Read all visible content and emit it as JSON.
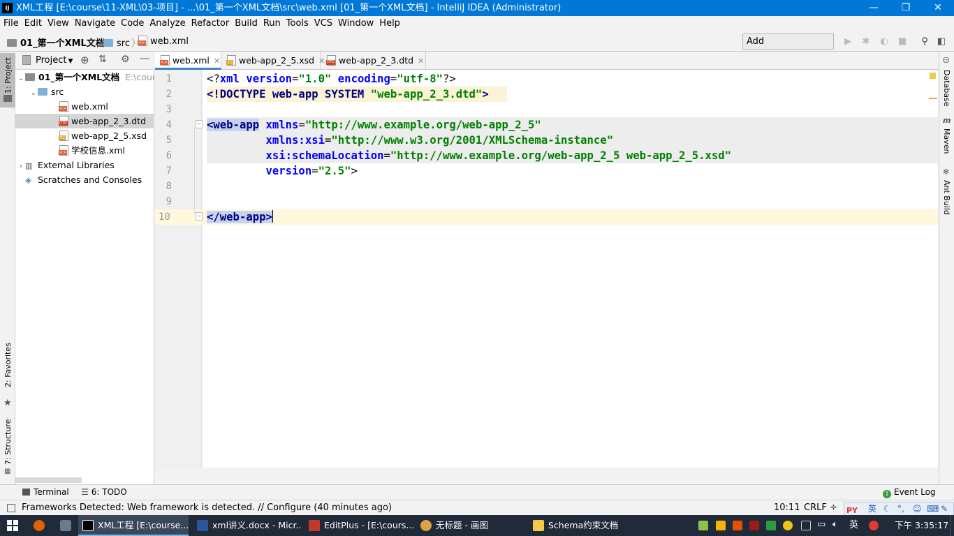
{
  "window": {
    "title": "XML工程 [E:\\course\\11-XML\\03-项目] - ...\\01_第一个XML文档\\src\\web.xml [01_第一个XML文档] - IntelliJ IDEA (Administrator)",
    "icon_label": "IJ",
    "minimize": "—",
    "restore": "❐",
    "close": "✕"
  },
  "menu": [
    "File",
    "Edit",
    "View",
    "Navigate",
    "Code",
    "Analyze",
    "Refactor",
    "Build",
    "Run",
    "Tools",
    "VCS",
    "Window",
    "Help"
  ],
  "breadcrumb": {
    "project": "01_第一个XML文档",
    "folder": "src",
    "file": "web.xml",
    "sep": "〉"
  },
  "toolbar": {
    "add_configuration": "Add Configuration..."
  },
  "left_strip": {
    "project": "1: Project",
    "favorites": "2: Favorites",
    "structure": "7: Structure"
  },
  "project_panel": {
    "header": "Project",
    "root_name": "01_第一个XML文档",
    "root_path": "E:\\cours",
    "items": [
      "src",
      "web.xml",
      "web-app_2_3.dtd",
      "web-app_2_5.xsd",
      "学校信息.xml",
      "External Libraries",
      "Scratches and Consoles"
    ]
  },
  "tabs": [
    "web.xml",
    "web-app_2_5.xsd",
    "web-app_2_3.dtd"
  ],
  "gutter_lines": [
    "1",
    "2",
    "3",
    "4",
    "5",
    "6",
    "7",
    "8",
    "9",
    "10"
  ],
  "code": {
    "l1": {
      "a": "<?",
      "b": "xml",
      "c": " version",
      "d": "=",
      "e": "\"1.0\"",
      "f": " encoding",
      "g": "=",
      "h": "\"utf-8\"",
      "i": "?>"
    },
    "l2": {
      "a": "<!DOCTYPE web-app SYSTEM ",
      "b": "\"web-app_2_3.dtd\"",
      "c": ">"
    },
    "l4": {
      "a": "<web-app",
      "b": " xmlns",
      "c": "=",
      "d": "\"http://www.example.org/web-app_2_5\""
    },
    "l5": {
      "a": "         xmlns:xsi",
      "b": "=",
      "c": "\"http://www.w3.org/2001/XMLSchema-instance\""
    },
    "l6": {
      "a": "         xsi:schemaLocation",
      "b": "=",
      "c": "\"http://www.example.org/web-app_2_5 web-app_2_5.xsd\""
    },
    "l7": {
      "a": "         version",
      "b": "=",
      "c": "\"2.5\"",
      "d": ">"
    },
    "l10": {
      "a": "</web-app>"
    }
  },
  "right_strip": {
    "database": "Database",
    "maven": "Maven",
    "ant": "Ant Build"
  },
  "bottom": {
    "terminal": "Terminal",
    "todo": "6: TODO",
    "event_log": "Event Log"
  },
  "status": {
    "message": "Frameworks Detected: Web framework is detected. // Configure (40 minutes ago)",
    "position": "10:11",
    "line_sep": "CRLF ÷"
  },
  "taskbar": {
    "items": [
      "XML工程 [E:\\course...",
      "xml讲义.docx - Micr...",
      "EditPlus - [E:\\cours...",
      "无标题 - 画图",
      "Schema约束文档"
    ],
    "ime": "英",
    "clock": "下午 3:35:17"
  },
  "colors": {
    "titlebar": "#0078d7",
    "taskbar": "#202a38",
    "selection": "#3875d7"
  }
}
